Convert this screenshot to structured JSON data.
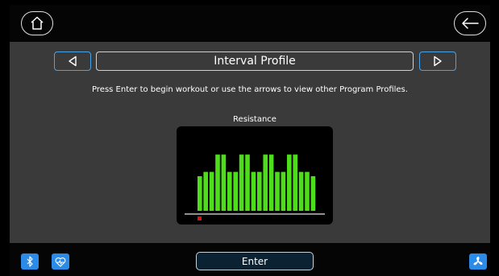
{
  "header": {
    "home_icon": "home-icon",
    "back_icon": "back-arrow-icon"
  },
  "profile": {
    "title": "Interval Profile",
    "prev_icon": "triangle-left-icon",
    "next_icon": "triangle-right-icon"
  },
  "instruction": "Press Enter to begin workout or use the arrows to view other Program Profiles.",
  "chart_data": {
    "type": "bar",
    "ylabel": "Resistance",
    "values": [
      8,
      9,
      9,
      13,
      13,
      9,
      9,
      13,
      13,
      9,
      9,
      13,
      13,
      9,
      9,
      13,
      13,
      9,
      9,
      8
    ],
    "ylim": [
      0,
      16
    ],
    "bar_color": "#4ddd1a",
    "current_segment": 0,
    "marker_color": "#e01010"
  },
  "footer": {
    "enter_label": "Enter",
    "bluetooth_icon": "bluetooth-icon",
    "heart_rate_icon": "heart-rate-icon",
    "fan_icon": "fan-icon"
  },
  "colors": {
    "accent": "#2b8be6",
    "panel": "#3a3a3a"
  }
}
